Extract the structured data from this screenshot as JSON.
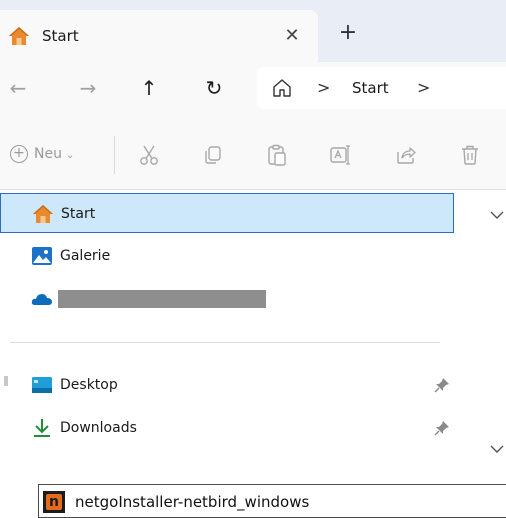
{
  "tab": {
    "title": "Start",
    "close_glyph": "✕",
    "new_tab_glyph": "+"
  },
  "nav": {
    "back_glyph": "←",
    "forward_glyph": "→",
    "up_glyph": "↑",
    "refresh_glyph": "↻",
    "address": {
      "separator": ">",
      "crumbs": [
        "Start"
      ]
    }
  },
  "toolbar": {
    "new_label": "Neu",
    "new_plus_glyph": "+",
    "new_chevron": "⌄"
  },
  "navpane": {
    "items": [
      {
        "label": "Start",
        "icon": "home-icon",
        "selected": true
      },
      {
        "label": "Galerie",
        "icon": "gallery-icon",
        "selected": false
      },
      {
        "label": "",
        "icon": "onedrive-cloud-icon",
        "redacted": true
      },
      {
        "label": "Desktop",
        "icon": "desktop-folder-icon",
        "pinned": true
      },
      {
        "label": "Downloads",
        "icon": "downloads-icon",
        "pinned": true
      }
    ]
  },
  "taskbar_item": {
    "label": "netgoInstaller-netbird_windows",
    "icon": "netgo-app-icon",
    "icon_letter": "n"
  },
  "colors": {
    "tabbar_bg": "#e9eef6",
    "selected_bg": "#cde8fa",
    "selected_border": "#2f6dbb",
    "home_orange": "#e98a2f",
    "accent_blue": "#1a73c8"
  }
}
